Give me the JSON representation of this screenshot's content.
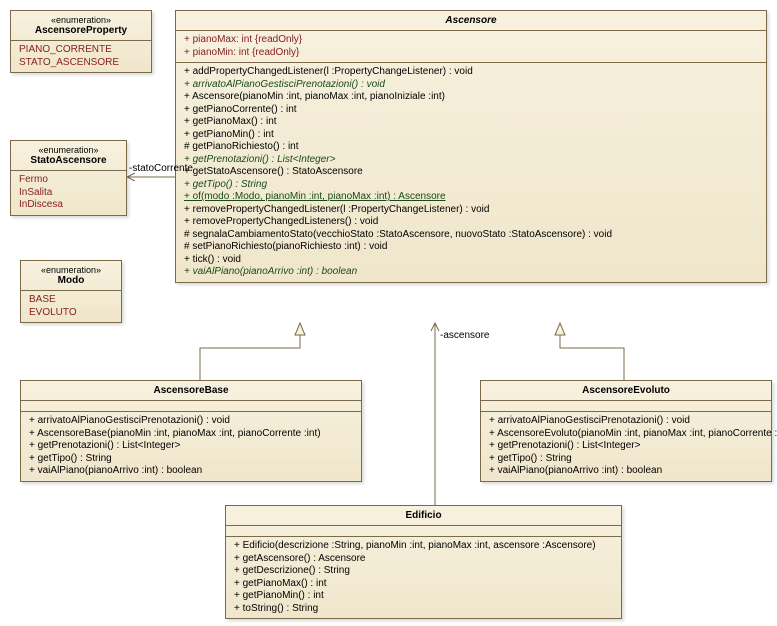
{
  "diagram": {
    "classes": {
      "ascensoreProperty": {
        "stereotype": "«enumeration»",
        "name": "AscensoreProperty",
        "literals": [
          "PIANO_CORRENTE",
          "STATO_ASCENSORE"
        ]
      },
      "statoAscensore": {
        "stereotype": "«enumeration»",
        "name": "StatoAscensore",
        "literals": [
          "Fermo",
          "InSalita",
          "InDiscesa"
        ]
      },
      "modo": {
        "stereotype": "«enumeration»",
        "name": "Modo",
        "literals": [
          "BASE",
          "EVOLUTO"
        ]
      },
      "ascensore": {
        "name": "Ascensore",
        "attributes": [
          "+   pianoMax: int {readOnly}",
          "+   pianoMin: int {readOnly}"
        ],
        "ops": [
          {
            "t": "+   addPropertyChangedListener(l :PropertyChangeListener) : void",
            "abs": false
          },
          {
            "t": "+   arrivatoAlPianoGestisciPrenotazioni() : void",
            "abs": true
          },
          {
            "t": "+   Ascensore(pianoMin :int, pianoMax :int, pianoIniziale :int)",
            "abs": false
          },
          {
            "t": "+   getPianoCorrente() : int",
            "abs": false
          },
          {
            "t": "+   getPianoMax() : int",
            "abs": false
          },
          {
            "t": "+   getPianoMin() : int",
            "abs": false
          },
          {
            "t": "#   getPianoRichiesto() : int",
            "abs": false
          },
          {
            "t": "+   getPrenotazioni() : List<Integer>",
            "abs": true
          },
          {
            "t": "+   getStatoAscensore() : StatoAscensore",
            "abs": false
          },
          {
            "t": "+   getTipo() : String",
            "abs": true
          },
          {
            "t": "+   of(modo :Modo, pianoMin :int, pianoMax :int) : Ascensore",
            "static": true
          },
          {
            "t": "+   removePropertyChangedListener(l :PropertyChangeListener) : void",
            "abs": false
          },
          {
            "t": "+   removePropertyChangedListeners() : void",
            "abs": false
          },
          {
            "t": "#   segnalaCambiamentoStato(vecchioStato :StatoAscensore, nuovoStato :StatoAscensore) : void",
            "abs": false
          },
          {
            "t": "#   setPianoRichiesto(pianoRichiesto :int) : void",
            "abs": false
          },
          {
            "t": "+   tick() : void",
            "abs": false
          },
          {
            "t": "+   vaiAlPiano(pianoArrivo :int) : boolean",
            "abs": true
          }
        ]
      },
      "ascensoreBase": {
        "name": "AscensoreBase",
        "ops": [
          "+   arrivatoAlPianoGestisciPrenotazioni() : void",
          "+   AscensoreBase(pianoMin :int, pianoMax :int, pianoCorrente :int)",
          "+   getPrenotazioni() : List<Integer>",
          "+   getTipo() : String",
          "+   vaiAlPiano(pianoArrivo :int) : boolean"
        ]
      },
      "ascensoreEvoluto": {
        "name": "AscensoreEvoluto",
        "ops": [
          "+   arrivatoAlPianoGestisciPrenotazioni() : void",
          "+   AscensoreEvoluto(pianoMin :int, pianoMax :int, pianoCorrente :int)",
          "+   getPrenotazioni() : List<Integer>",
          "+   getTipo() : String",
          "+   vaiAlPiano(pianoArrivo :int) : boolean"
        ]
      },
      "edificio": {
        "name": "Edificio",
        "ops": [
          "+   Edificio(descrizione :String, pianoMin :int, pianoMax :int, ascensore :Ascensore)",
          "+   getAscensore() : Ascensore",
          "+   getDescrizione() : String",
          "+   getPianoMax() : int",
          "+   getPianoMin() : int",
          "+   toString() : String"
        ]
      }
    },
    "roles": {
      "statoCorrente": "-statoCorrente",
      "ascensore": "-ascensore"
    }
  }
}
